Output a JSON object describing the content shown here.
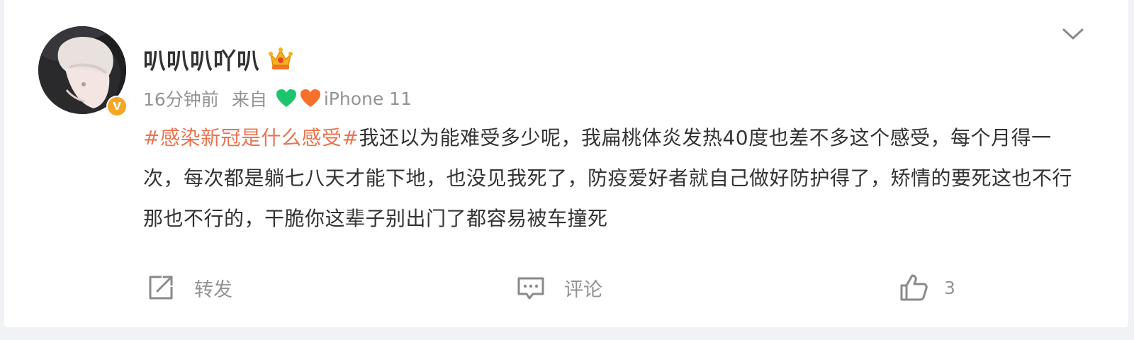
{
  "post": {
    "user": {
      "nickname": "叭叭叭吖叭",
      "verified_badge": "V",
      "member_icon": "crown-icon"
    },
    "meta": {
      "time": "16分钟前",
      "from_label": "来自",
      "device": "iPhone 11",
      "device_icons": [
        "green-heart-icon",
        "orange-heart-icon"
      ]
    },
    "content": {
      "topic": "#感染新冠是什么感受#",
      "text": "我还以为能难受多少呢，我扁桃体炎发热40度也差不多这个感受，每个月得一次，每次都是躺七八天才能下地，也没见我死了，防疫爱好者就自己做好防护得了，矫情的要死这也不行那也不行的，干脆你这辈子别出门了都容易被车撞死"
    },
    "actions": {
      "forward_label": "转发",
      "comment_label": "评论",
      "like_count": "3"
    }
  },
  "colors": {
    "topic": "#eb7350",
    "text": "#333333",
    "meta": "#939393",
    "badge": "#f6a623",
    "heart_green": "#1ec46d",
    "heart_orange": "#f7702a"
  }
}
